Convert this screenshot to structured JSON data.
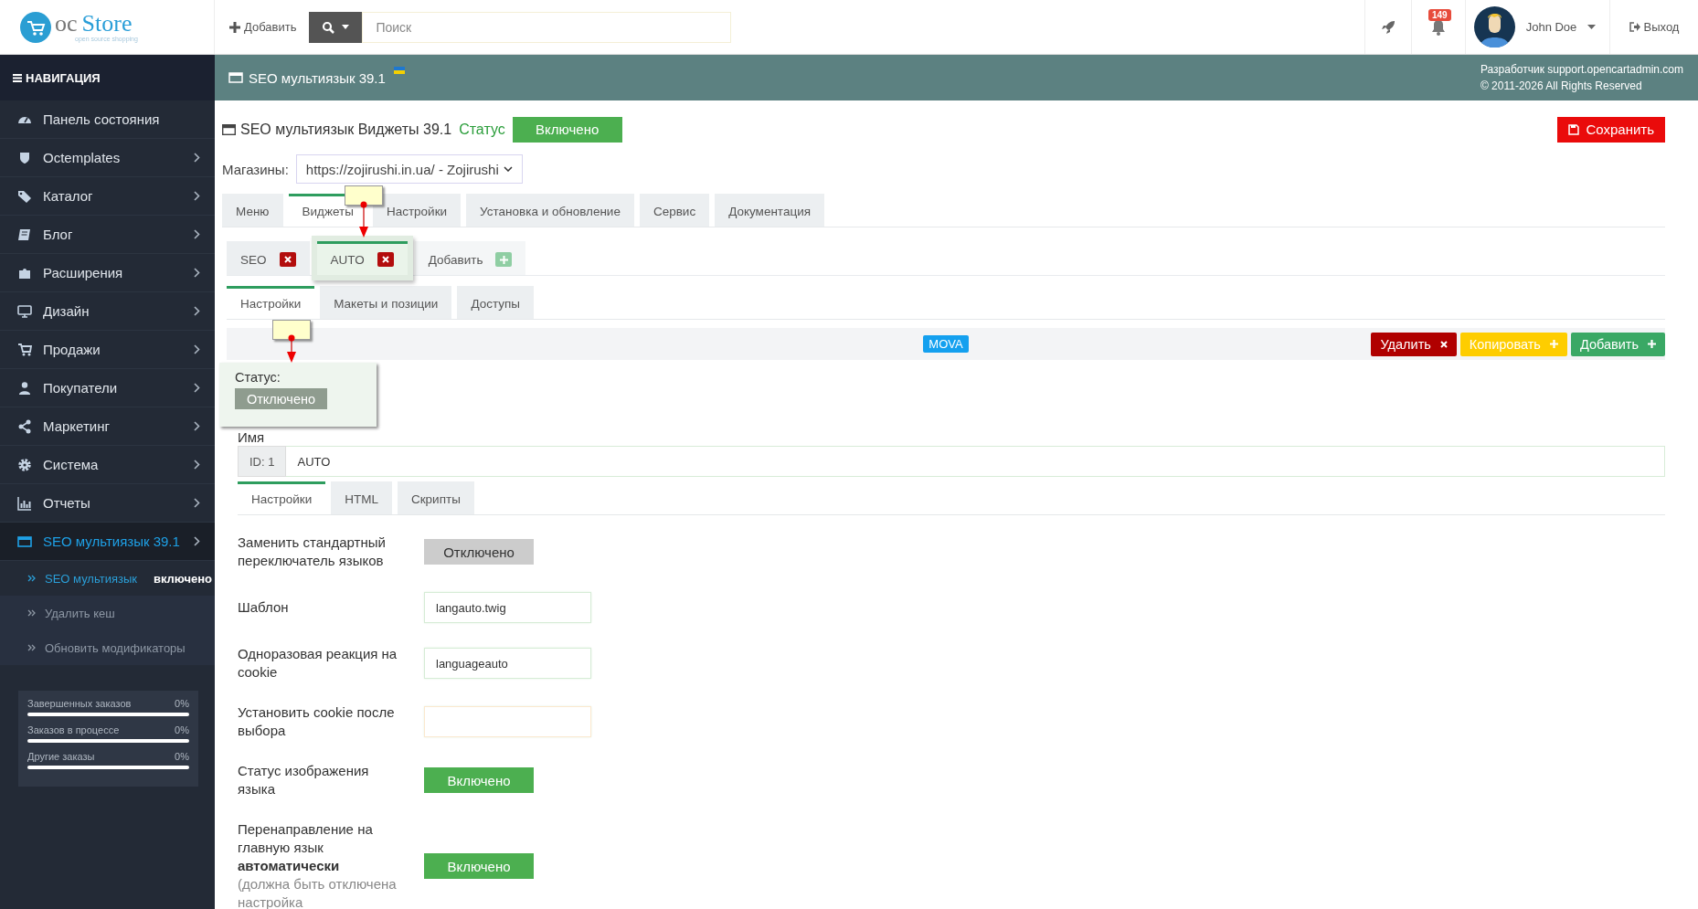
{
  "header": {
    "logo": {
      "prefix": "oc",
      "name": "Store",
      "tagline": "open source shopping"
    },
    "add_button": "Добавить",
    "search": {
      "placeholder": "Поиск"
    },
    "notifications_badge": "149",
    "user": "John Doe",
    "logout": "Выход"
  },
  "sidebar": {
    "title": "НАВИГАЦИЯ",
    "items": [
      {
        "label": "Панель состояния",
        "expandable": false,
        "selected": false
      },
      {
        "label": "Octemplates",
        "expandable": true,
        "selected": false
      },
      {
        "label": "Каталог",
        "expandable": true,
        "selected": false
      },
      {
        "label": "Блог",
        "expandable": true,
        "selected": false
      },
      {
        "label": "Расширения",
        "expandable": true,
        "selected": false
      },
      {
        "label": "Дизайн",
        "expandable": true,
        "selected": false
      },
      {
        "label": "Продажи",
        "expandable": true,
        "selected": false
      },
      {
        "label": "Покупатели",
        "expandable": true,
        "selected": false
      },
      {
        "label": "Маркетинг",
        "expandable": true,
        "selected": false
      },
      {
        "label": "Система",
        "expandable": true,
        "selected": false
      },
      {
        "label": "Отчеты",
        "expandable": true,
        "selected": false
      },
      {
        "label": "SEO мультиязык 39.1",
        "expandable": true,
        "selected": true
      }
    ],
    "submenu": [
      {
        "label": "SEO мультиязык",
        "badge": "включено",
        "selected": true
      },
      {
        "label": "Удалить кеш",
        "selected": false
      },
      {
        "label": "Обновить модификаторы",
        "selected": false
      }
    ],
    "stats": [
      {
        "label": "Завершенных заказов",
        "value": "0%",
        "level": 0
      },
      {
        "label": "Заказов в процессе",
        "value": "0%",
        "level": 0
      },
      {
        "label": "Другие заказы",
        "value": "0%",
        "level": 0
      }
    ]
  },
  "page_header": {
    "title": "SEO мультиязык 39.1",
    "credits": [
      "Разработчик support.opencartadmin.com",
      "© 2011-2026 All Rights Reserved"
    ]
  },
  "module": {
    "title": "SEO мультиязык Виджеты 39.1",
    "status_label": "Статус",
    "status": {
      "label": "Включено",
      "on": true
    },
    "save_button": "Сохранить",
    "stores_label": "Магазины:",
    "store": "https://zojirushi.in.ua/ - Zojirushi",
    "tabs": [
      {
        "label": "Меню",
        "selected": false
      },
      {
        "label": "Виджеты",
        "selected": true
      },
      {
        "label": "Настройки",
        "selected": false
      },
      {
        "label": "Установка и обновление",
        "selected": false
      },
      {
        "label": "Сервис",
        "selected": false
      },
      {
        "label": "Документация",
        "selected": false
      }
    ],
    "widgets": [
      {
        "label": "SEO",
        "kind": "widget",
        "selected": false
      },
      {
        "label": "AUTO",
        "kind": "widget",
        "selected": true
      },
      {
        "label": "Добавить",
        "kind": "add",
        "selected": false
      }
    ],
    "widget_tabs": [
      {
        "label": "Настройки",
        "selected": true
      },
      {
        "label": "Макеты и позиции",
        "selected": false
      },
      {
        "label": "Доступы",
        "selected": false
      }
    ],
    "language_bar": {
      "badge": "MOVA",
      "buttons": [
        {
          "label": "Удалить",
          "kind": "delete"
        },
        {
          "label": "Копировать",
          "kind": "copy"
        },
        {
          "label": "Добавить",
          "kind": "add"
        }
      ]
    },
    "status_popup": {
      "label": "Статус:",
      "toggle": {
        "label": "Отключено",
        "on": false
      }
    },
    "name_field": {
      "label": "Имя",
      "addon": "ID: 1",
      "value": "AUTO"
    },
    "inner_tabs": [
      {
        "label": "Настройки",
        "selected": true
      },
      {
        "label": "HTML",
        "selected": false
      },
      {
        "label": "Скрипты",
        "selected": false
      }
    ],
    "fields": [
      {
        "kind": "toggle",
        "label": "Заменить стандартный переключатель языков",
        "toggle": {
          "label": "Отключено",
          "on": false
        }
      },
      {
        "kind": "input",
        "label": "Шаблон",
        "value": "langauto.twig"
      },
      {
        "kind": "input",
        "label": "Одноразовая реакция на cookie",
        "value": "languageauto"
      },
      {
        "kind": "input",
        "label": "Установить cookie после выбора"
      },
      {
        "kind": "toggle",
        "label": "Статус изображения языка",
        "toggle": {
          "label": "Включено",
          "on": true
        }
      },
      {
        "kind": "toggle",
        "label": "Перенаправление на главную язык **автоматически**",
        "hint": "(должна быть отключена настройка",
        "toggle": {
          "label": "Включено",
          "on": true
        }
      }
    ]
  }
}
